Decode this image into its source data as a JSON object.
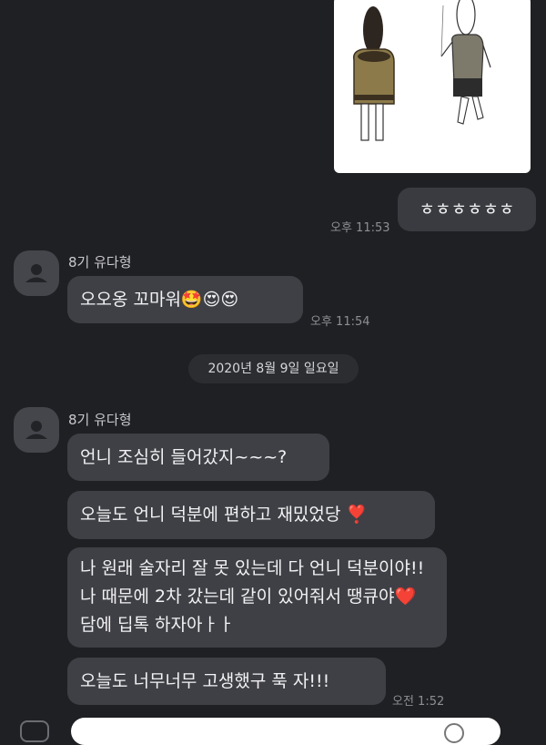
{
  "chat": {
    "shared_image": {
      "alt": "cartoon image"
    },
    "messages": [
      {
        "text": "ㅎㅎㅎㅎㅎㅎ",
        "time": "오후 11:53"
      },
      {
        "sender": "8기 유다형",
        "text": "오오옹 꼬마워🤩😍😍",
        "time": "오후 11:54"
      },
      {
        "sender": "8기 유다형",
        "text": "언니 조심히 들어갔지~~~?"
      },
      {
        "text": "오늘도 언니 덕분에 편하고 재밌었당 ❣️"
      },
      {
        "text": "나 원래 술자리 잘 못 있는데 다 언니 덕분이야!! 나 때문에 2차 갔는데 같이 있어줘서 땡큐야❤️ 담에 딥톡 하자아ㅏㅏ"
      },
      {
        "text": "오늘도 너무너무 고생했구 푹 자!!!",
        "time": "오전 1:52"
      }
    ],
    "date_divider": "2020년 8월 9일 일요일"
  }
}
